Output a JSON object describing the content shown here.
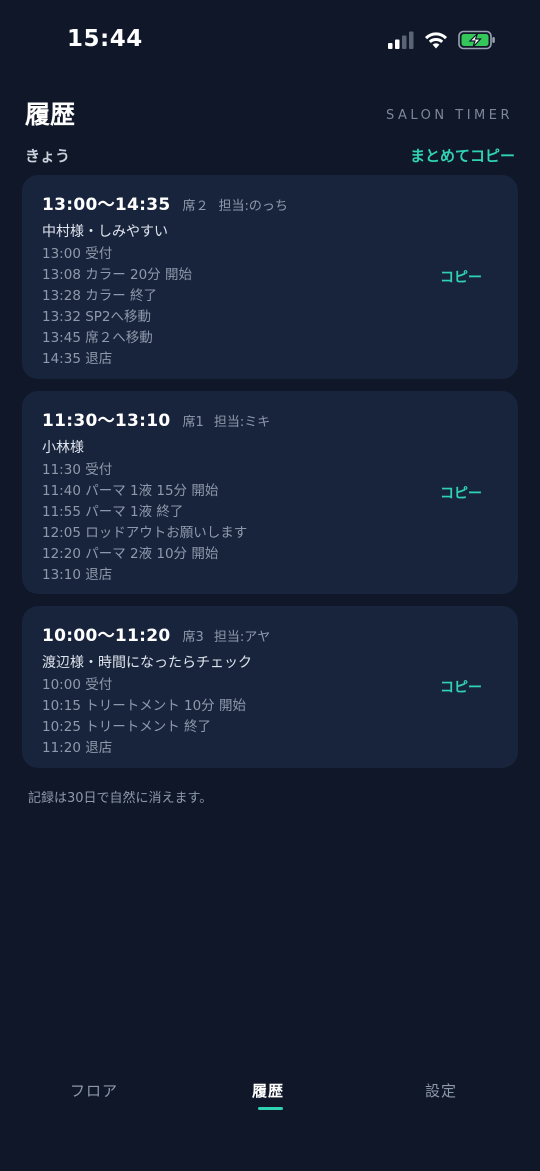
{
  "status_bar": {
    "time": "15:44"
  },
  "header": {
    "title": "履歴",
    "brand": "SALON TIMER"
  },
  "section": {
    "label": "きょう",
    "copy_all_label": "まとめてコピー"
  },
  "cards": [
    {
      "time": "13:00〜14:35",
      "seat": "席２",
      "staff": "担当:のっち",
      "customer": "中村様・しみやすい",
      "copy_label": "コピー",
      "log": [
        "13:00 受付",
        "13:08 カラー 20分 開始",
        "13:28 カラー 終了",
        "13:32 SP2へ移動",
        "13:45 席２へ移動",
        "14:35 退店"
      ]
    },
    {
      "time": "11:30〜13:10",
      "seat": "席1",
      "staff": "担当:ミキ",
      "customer": "小林様",
      "copy_label": "コピー",
      "log": [
        "11:30 受付",
        "11:40 パーマ 1液 15分 開始",
        "11:55 パーマ 1液 終了",
        "12:05 ロッドアウトお願いします",
        "12:20 パーマ 2液 10分 開始",
        "13:10 退店"
      ]
    },
    {
      "time": "10:00〜11:20",
      "seat": "席3",
      "staff": "担当:アヤ",
      "customer": "渡辺様・時間になったらチェック",
      "copy_label": "コピー",
      "log": [
        "10:00 受付",
        "10:15 トリートメント 10分 開始",
        "10:25 トリートメント 終了",
        "11:20 退店"
      ]
    }
  ],
  "footnote": "記録は30日で自然に消えます。",
  "tabs": [
    {
      "label": "フロア",
      "active": false
    },
    {
      "label": "履歴",
      "active": true
    },
    {
      "label": "設定",
      "active": false
    }
  ],
  "colors": {
    "background": "#0f1729",
    "card": "#18243c",
    "accent": "#2fd3b4",
    "muted_text": "#8e99ab"
  },
  "icons": [
    "cellular-signal-icon",
    "wifi-icon",
    "battery-charging-icon"
  ]
}
